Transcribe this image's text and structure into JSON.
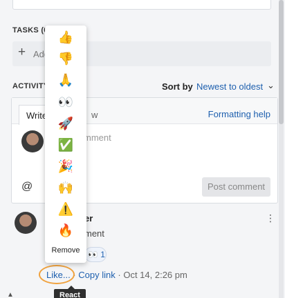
{
  "tasks": {
    "label": "TASKS (0/",
    "add_label": "Add"
  },
  "activity": {
    "label": "ACTIVITY",
    "sort_label": "Sort by",
    "sort_value": "Newest to oldest"
  },
  "editor": {
    "tab_write": "Write",
    "tab_preview": "w",
    "formatting_help": "Formatting help",
    "placeholder": "mment",
    "mention_icon": "@",
    "post_button": "Post comment"
  },
  "comment": {
    "author_fragment": "er",
    "text_fragment": "ment",
    "reaction_emoji": "👀",
    "reaction_count": "1",
    "like_label": "Like...",
    "separator": "·",
    "copy_link": "Copy link",
    "timestamp": "Oct 14, 2:26 pm"
  },
  "tooltip": {
    "text": "React"
  },
  "emoji_menu": {
    "items": [
      {
        "name": "thumbs-up",
        "glyph": "👍"
      },
      {
        "name": "thumbs-down",
        "glyph": "👎"
      },
      {
        "name": "folded-hands",
        "glyph": "🙏"
      },
      {
        "name": "eyes",
        "glyph": "👀"
      },
      {
        "name": "rocket",
        "glyph": "🚀"
      },
      {
        "name": "check-mark",
        "glyph": "✅"
      },
      {
        "name": "party-popper",
        "glyph": "🎉"
      },
      {
        "name": "raised-hands",
        "glyph": "🙌"
      },
      {
        "name": "warning",
        "glyph": "⚠️"
      },
      {
        "name": "fire",
        "glyph": "🔥"
      }
    ],
    "remove_label": "Remove"
  },
  "colors": {
    "link": "#1d5fae",
    "highlight_ring": "#f0a23e"
  }
}
